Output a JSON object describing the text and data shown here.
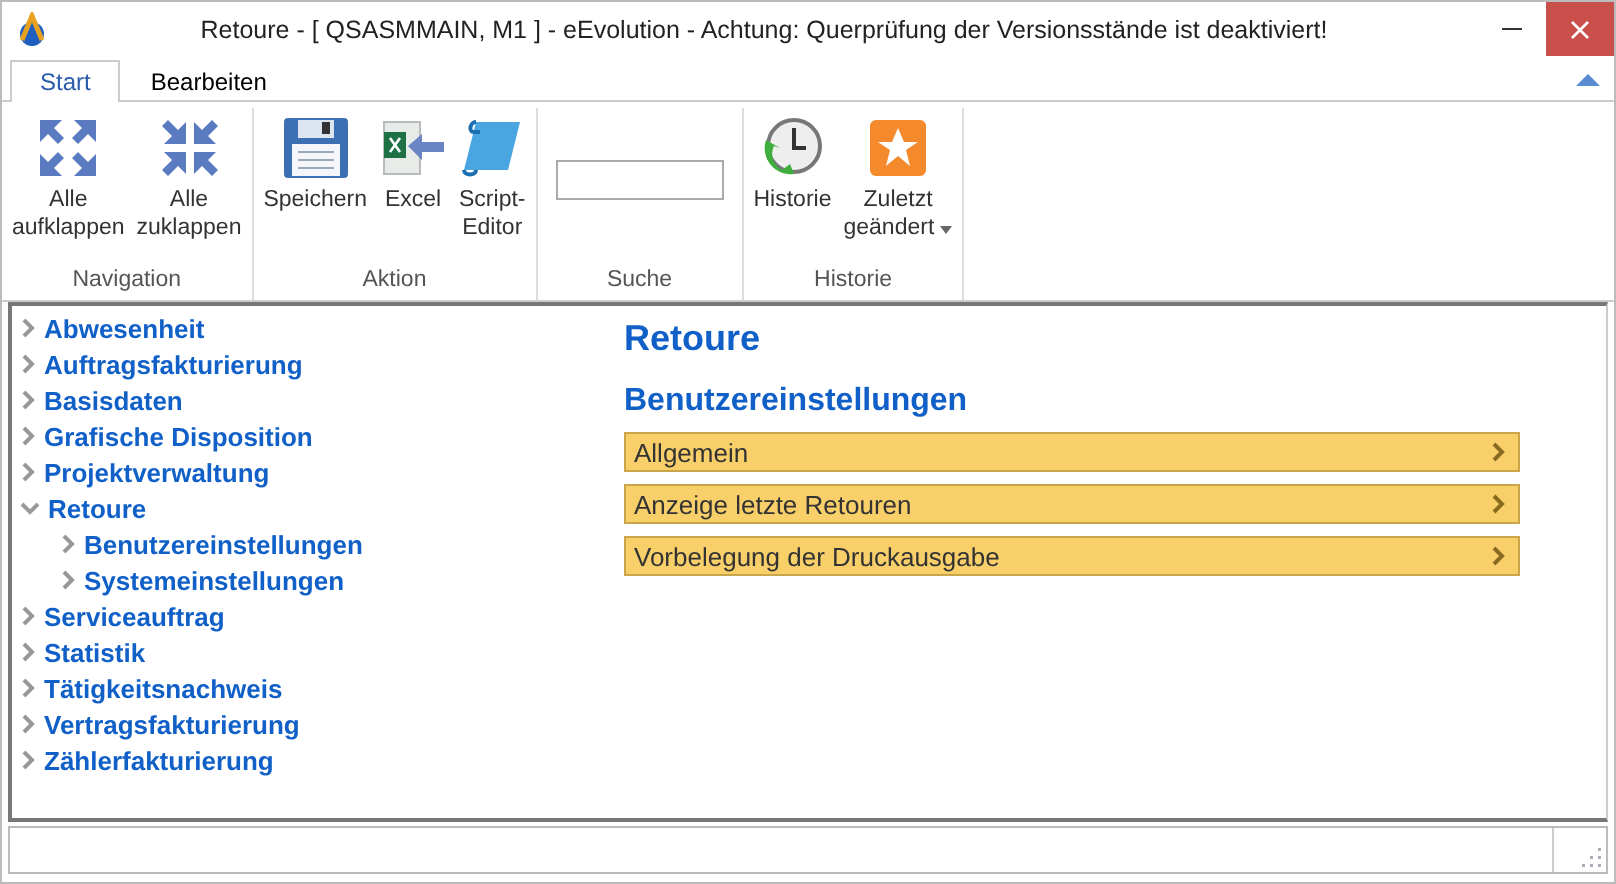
{
  "window": {
    "title": "Retoure - [ QSASMMAIN, M1 ]  -  eEvolution - Achtung: Querprüfung der Versionsstände ist deaktiviert!"
  },
  "tabs": [
    {
      "label": "Start",
      "selected": true
    },
    {
      "label": "Bearbeiten",
      "selected": false
    }
  ],
  "ribbon_groups": [
    {
      "label": "Navigation",
      "buttons": [
        {
          "label": "Alle\naufklappen"
        },
        {
          "label": "Alle\nzuklappen"
        }
      ]
    },
    {
      "label": "Aktion",
      "buttons": [
        {
          "label": "Speichern"
        },
        {
          "label": "Excel"
        },
        {
          "label": "Script-\nEditor"
        }
      ]
    },
    {
      "label": "Suche",
      "kind": "search"
    },
    {
      "label": "Historie",
      "buttons": [
        {
          "label": "Historie"
        },
        {
          "label": "Zuletzt\ngeändert",
          "dropdown": true
        }
      ]
    }
  ],
  "tree": [
    {
      "label": "Abwesenheit",
      "expanded": false
    },
    {
      "label": "Auftragsfakturierung",
      "expanded": false
    },
    {
      "label": "Basisdaten",
      "expanded": false
    },
    {
      "label": "Grafische Disposition",
      "expanded": false
    },
    {
      "label": "Projektverwaltung",
      "expanded": false
    },
    {
      "label": "Retoure",
      "expanded": true,
      "children": [
        {
          "label": "Benutzereinstellungen",
          "expanded": false
        },
        {
          "label": "Systemeinstellungen",
          "expanded": false
        }
      ]
    },
    {
      "label": "Serviceauftrag",
      "expanded": false
    },
    {
      "label": "Statistik",
      "expanded": false
    },
    {
      "label": "Tätigkeitsnachweis",
      "expanded": false
    },
    {
      "label": "Vertragsfakturierung",
      "expanded": false
    },
    {
      "label": "Zählerfakturierung",
      "expanded": false
    }
  ],
  "content": {
    "title": "Retoure",
    "subtitle": "Benutzereinstellungen",
    "sections": [
      {
        "label": "Allgemein"
      },
      {
        "label": "Anzeige letzte Retouren"
      },
      {
        "label": "Vorbelegung der Druckausgabe"
      }
    ]
  }
}
